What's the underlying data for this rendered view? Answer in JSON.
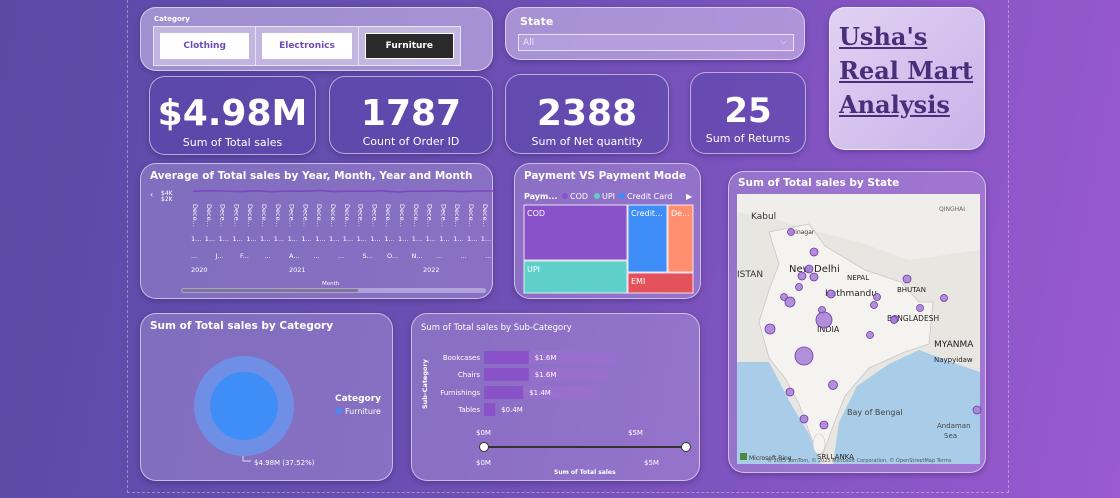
{
  "category_slicer": {
    "title": "Category",
    "options": [
      {
        "label": "Clothing",
        "selected": false
      },
      {
        "label": "Electronics",
        "selected": false
      },
      {
        "label": "Furniture",
        "selected": true
      }
    ]
  },
  "state_slicer": {
    "title": "State",
    "value": "All"
  },
  "brand": {
    "title_line1": "Usha's",
    "title_line2": "Real Mart",
    "title_line3": "Analysis"
  },
  "kpis": [
    {
      "value": "$4.98M",
      "label": "Sum of Total sales"
    },
    {
      "value": "1787",
      "label": "Count of Order ID"
    },
    {
      "value": "2388",
      "label": "Sum of Net quantity"
    },
    {
      "value": "25",
      "label": "Sum of Returns"
    }
  ],
  "line_chart": {
    "title": "Average of Total sales by Year, Month, Year and Month",
    "y_ticks": [
      "$4K",
      "$2K"
    ],
    "month_tick": "Dece...",
    "row2_tick": "1...",
    "row3_ticks": [
      "...",
      "J...",
      "F...",
      "...",
      "A...",
      "...",
      "...",
      "S...",
      "O...",
      "N...",
      "...",
      "...",
      "..."
    ],
    "years": [
      "2020",
      "2021",
      "2022"
    ],
    "xlabel": "Month"
  },
  "treemap": {
    "title": "Payment VS Payment Mode",
    "legend_title": "Paym...",
    "legend": [
      {
        "name": "COD",
        "color": "#8a52c8"
      },
      {
        "name": "UPI",
        "color": "#5ecfc9"
      },
      {
        "name": "Credit Card",
        "color": "#3f8ef7"
      }
    ],
    "tiles": [
      {
        "label": "COD",
        "color": "#8a52c8"
      },
      {
        "label": "UPI",
        "color": "#5ecfc9"
      },
      {
        "label": "Credit...",
        "color": "#3f8ef7"
      },
      {
        "label": "De...",
        "color": "#ff8f6e"
      },
      {
        "label": "EMI",
        "color": "#e5515b"
      }
    ]
  },
  "map": {
    "title": "Sum of Total sales by State",
    "places": [
      "Kabul",
      "Srinagar",
      "ISTAN",
      "New Delhi",
      "NEPAL",
      "Kathmandu",
      "BHUTAN",
      "BANGLADESH",
      "INDIA",
      "MYANMA",
      "Naypyidaw",
      "Bay of Bengal",
      "SRI LANKA",
      "Andaman",
      "Sea",
      "QINGHAI"
    ],
    "attribution": "© 2025 TomTom, © 2025 Microsoft Corporation, © OpenStreetMap  Terms",
    "logo": "Microsoft Bing"
  },
  "donut": {
    "title": "Sum of Total sales by Category",
    "legend_title": "Category",
    "legend": [
      {
        "name": "Furniture",
        "color": "#3f8ef7"
      }
    ],
    "data_label": "$4.98M (37.52%)"
  },
  "subcategory_chart": {
    "title": "Sum of Total sales by Sub-Category",
    "ylabel": "Sub-Category",
    "xlabel": "Sum of Total sales",
    "x_ticks_top": [
      "$0M",
      "$5M"
    ],
    "x_ticks_bottom": [
      "$0M",
      "$5M"
    ]
  },
  "chart_data": [
    {
      "type": "bar",
      "orientation": "horizontal",
      "title": "Sum of Total sales by Sub-Category",
      "xlabel": "Sum of Total sales",
      "ylabel": "Sub-Category",
      "categories": [
        "Bookcases",
        "Chairs",
        "Furnishings",
        "Tables"
      ],
      "values": [
        1.6,
        1.6,
        1.4,
        0.4
      ],
      "data_labels": [
        "$1.6M",
        "$1.6M",
        "$1.4M",
        "$0.4M"
      ],
      "xlim": [
        0,
        5
      ],
      "bar_color": "#8a52c8",
      "grid": false
    },
    {
      "type": "pie",
      "title": "Sum of Total sales by Category",
      "categories": [
        "Furniture"
      ],
      "values": [
        4.98
      ],
      "percent": [
        37.52
      ],
      "colors": [
        "#3f8ef7"
      ],
      "legend_position": "right"
    },
    {
      "type": "line",
      "title": "Average of Total sales by Year, Month, Year and Month",
      "xlabel": "Month",
      "ylim": [
        0,
        4
      ],
      "ylabel_unit": "$K",
      "series": [
        {
          "values": [
            4.1,
            4.3,
            4.2,
            4.0,
            4.3,
            3.9,
            4.2,
            4.1,
            4.4,
            4.0,
            4.2,
            4.1,
            4.3,
            3.8,
            4.2,
            4.1,
            4.3,
            4.0,
            4.2,
            4.2,
            4.0,
            4.3,
            4.1,
            4.2,
            4.0,
            4.3,
            4.1,
            3.9
          ]
        }
      ]
    },
    {
      "type": "bar",
      "title": "Payment VS Payment Mode",
      "categories": [
        "COD",
        "UPI",
        "Credit Card",
        "Debit Card",
        "EMI"
      ],
      "values": [
        0.44,
        0.27,
        0.12,
        0.08,
        0.06
      ]
    }
  ]
}
